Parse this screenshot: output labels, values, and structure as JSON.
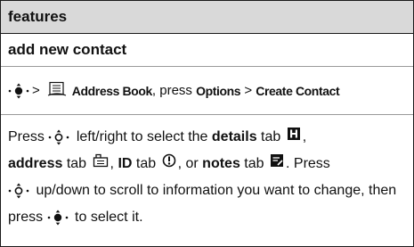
{
  "header": {
    "title": "features"
  },
  "section": {
    "title": "add new contact"
  },
  "path": {
    "separator_1": ">",
    "address_book": "Address Book",
    "press_text": ", press",
    "options": "Options",
    "separator_2": ">",
    "create_contact": "Create Contact"
  },
  "desc": {
    "press": "Press",
    "left_right": "left/right to select the",
    "details": "details",
    "tab1": "tab",
    "address": "address",
    "tab2": "tab",
    "id": "ID",
    "tab3": "tab",
    "or": ", or",
    "notes": "notes",
    "tab4": "tab",
    "press2": ". Press",
    "up_down": "up/down to scroll to information you want to change, then press",
    "select_it": "to select it."
  }
}
